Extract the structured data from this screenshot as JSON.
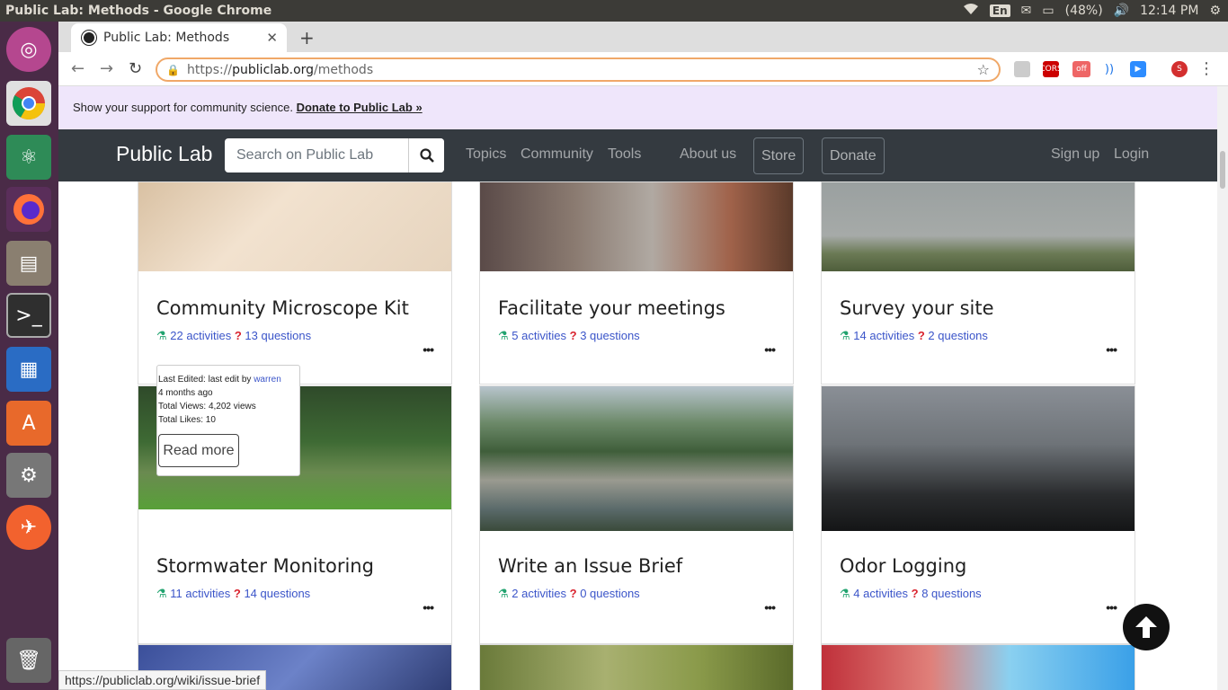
{
  "window": {
    "title": "Public Lab: Methods - Google Chrome"
  },
  "tray": {
    "lang": "En",
    "battery": "(48%)",
    "time": "12:14 PM"
  },
  "browser": {
    "tab_title": "Public Lab: Methods",
    "url_proto": "https://",
    "url_host": "publiclab.org",
    "url_path": "/methods",
    "ext_cors": "CORS",
    "ext_off": "off",
    "profile": "S"
  },
  "banner": {
    "text": "Show your support for community science.",
    "link": "Donate to Public Lab »"
  },
  "nav": {
    "brand": "Public Lab",
    "search_placeholder": "Search on Public Lab",
    "links": [
      "Topics",
      "Community",
      "Tools",
      "About us"
    ],
    "store": "Store",
    "donate": "Donate",
    "signup": "Sign up",
    "login": "Login"
  },
  "cards": [
    {
      "title": "Community Microscope Kit",
      "activities": "22 activities",
      "questions": "13 questions"
    },
    {
      "title": "Facilitate your meetings",
      "activities": "5 activities",
      "questions": "3 questions"
    },
    {
      "title": "Survey your site",
      "activities": "14 activities",
      "questions": "2 questions"
    },
    {
      "title": "Stormwater Monitoring",
      "activities": "11 activities",
      "questions": "14 questions"
    },
    {
      "title": "Write an Issue Brief",
      "activities": "2 activities",
      "questions": "0 questions"
    },
    {
      "title": "Odor Logging",
      "activities": "4 activities",
      "questions": "8 questions"
    }
  ],
  "popover": {
    "edited_prefix": "Last Edited: last edit by",
    "editor": "warren",
    "ago": "4 months ago",
    "views": "Total Views: 4,202 views",
    "likes": "Total Likes: 10",
    "read_more": "Read more"
  },
  "status_url": "https://publiclab.org/wiki/issue-brief"
}
